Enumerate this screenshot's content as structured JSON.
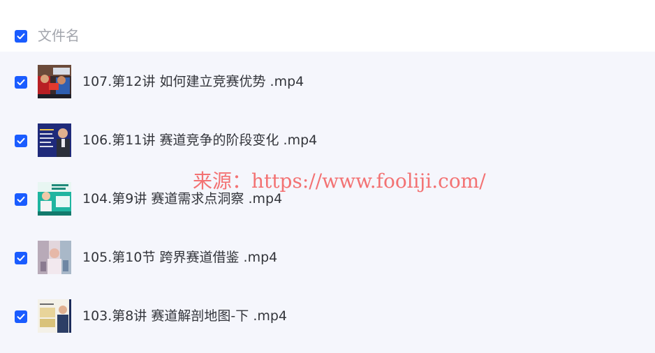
{
  "header": {
    "checked": true,
    "label": "文件名"
  },
  "files": [
    {
      "checked": true,
      "name": "107.第12讲 如何建立竞赛优势 .mp4",
      "thumbnail": "video-thumbnail-boxing"
    },
    {
      "checked": true,
      "name": "106.第11讲 赛道竞争的阶段变化 .mp4",
      "thumbnail": "video-thumbnail-presenter-blue"
    },
    {
      "checked": true,
      "name": "104.第9讲 赛道需求点洞察 .mp4",
      "thumbnail": "video-thumbnail-presenter-teal"
    },
    {
      "checked": true,
      "name": "105.第10节 跨界赛道借鉴 .mp4",
      "thumbnail": "video-thumbnail-product"
    },
    {
      "checked": true,
      "name": "103.第8讲 赛道解剖地图-下 .mp4",
      "thumbnail": "video-thumbnail-slide"
    }
  ],
  "watermark": "来源：https://www.fooliji.com/",
  "colors": {
    "accent": "#1a5cff",
    "list_background": "#f5f6fc",
    "header_text": "#a3a6ad",
    "file_text": "#33353b",
    "watermark": "#f25a5a"
  }
}
